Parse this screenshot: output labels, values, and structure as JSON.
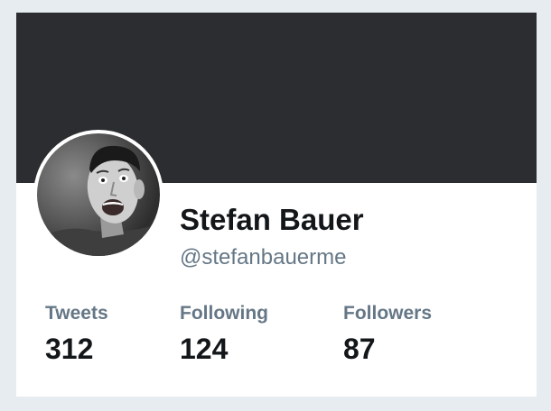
{
  "profile": {
    "name": "Stefan Bauer",
    "handle": "@stefanbauerme",
    "stats": [
      {
        "label": "Tweets",
        "value": "312"
      },
      {
        "label": "Following",
        "value": "124"
      },
      {
        "label": "Followers",
        "value": "87"
      }
    ]
  },
  "colors": {
    "banner": "#2b2d31",
    "page_background": "#e6ecf0",
    "muted_text": "#657786",
    "primary_text": "#14171a"
  }
}
